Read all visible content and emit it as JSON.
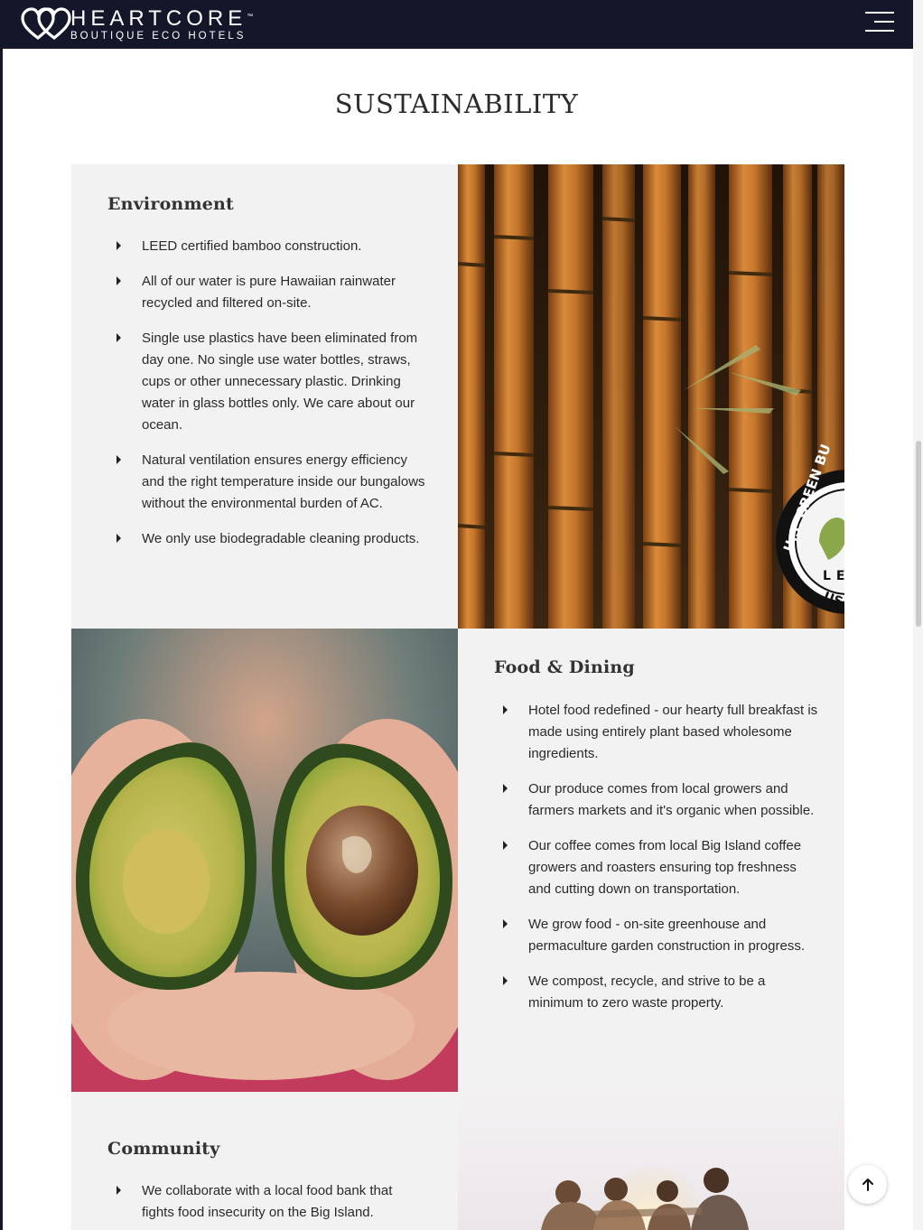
{
  "header": {
    "brand": "HEARTCORE",
    "trademark": "™",
    "tagline": "BOUTIQUE ECO HOTELS",
    "icons": {
      "logo": "double-heart-logo-icon",
      "menu": "hamburger-menu-icon"
    }
  },
  "page": {
    "title": "SUSTAINABILITY"
  },
  "sections": {
    "environment": {
      "heading": "Environment",
      "items": [
        "LEED certified bamboo construction.",
        "All of our water is pure Hawaiian rainwater recycled and filtered on-site.",
        "Single use plastics have been eliminated from day one. No single use water bottles, straws, cups or other unnecessary plastic. Drinking water in glass bottles only. We care about our ocean.",
        "Natural ventilation ensures energy efficiency and the right temperature inside our bungalows without the environmental burden of AC.",
        "We only use biodegradable cleaning products."
      ],
      "image": {
        "subject": "bamboo-photo",
        "badge": "U.S. GREEN BU",
        "badge_letters": "LE",
        "badge_bottom": "US"
      }
    },
    "food": {
      "heading": "Food & Dining",
      "items": [
        "Hotel food redefined - our hearty full breakfast is made using entirely plant based wholesome ingredients.",
        "Our produce comes from local growers and farmers markets and it's organic when possible.",
        "Our coffee comes from local Big Island coffee growers and roasters ensuring top freshness and cutting down on transportation.",
        "We grow food - on-site greenhouse and permaculture garden construction in progress.",
        "We compost, recycle, and strive to be a minimum to zero waste property."
      ],
      "image": {
        "subject": "avocado-photo"
      }
    },
    "community": {
      "heading": "Community",
      "items": [
        "We collaborate with a local food bank that fights food insecurity on the Big Island."
      ],
      "image": {
        "subject": "friends-sunset-photo"
      }
    }
  },
  "colors": {
    "header_bg": "#14172a",
    "panel_bg": "#f2f2f3",
    "text": "#2a2a2a"
  },
  "controls": {
    "back_to_top": "arrow-up-icon"
  }
}
